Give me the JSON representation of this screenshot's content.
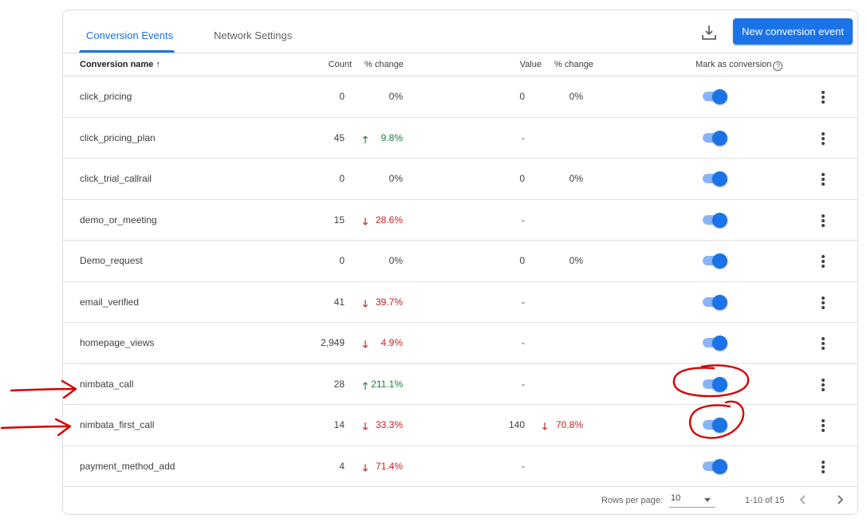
{
  "tabs": [
    {
      "label": "Conversion Events",
      "active": true
    },
    {
      "label": "Network Settings",
      "active": false
    }
  ],
  "toolbar": {
    "download_icon": "download-icon",
    "new_button_label": "New conversion event"
  },
  "columns": {
    "name": "Conversion name",
    "sort_indicator": "↑",
    "count": "Count",
    "count_change": "% change",
    "value": "Value",
    "value_change": "% change",
    "mark": "Mark as conversion",
    "help": "?"
  },
  "rows": [
    {
      "name": "click_pricing",
      "count": "0",
      "count_trend": "",
      "count_change": "0%",
      "value": "0",
      "value_trend": "",
      "value_change": "0%",
      "marked": true
    },
    {
      "name": "click_pricing_plan",
      "count": "45",
      "count_trend": "up",
      "count_change": "9.8%",
      "value": "-",
      "value_trend": "",
      "value_change": "",
      "marked": true
    },
    {
      "name": "click_trial_callrail",
      "count": "0",
      "count_trend": "",
      "count_change": "0%",
      "value": "0",
      "value_trend": "",
      "value_change": "0%",
      "marked": true
    },
    {
      "name": "demo_or_meeting",
      "count": "15",
      "count_trend": "down",
      "count_change": "28.6%",
      "value": "-",
      "value_trend": "",
      "value_change": "",
      "marked": true
    },
    {
      "name": "Demo_request",
      "count": "0",
      "count_trend": "",
      "count_change": "0%",
      "value": "0",
      "value_trend": "",
      "value_change": "0%",
      "marked": true
    },
    {
      "name": "email_verified",
      "count": "41",
      "count_trend": "down",
      "count_change": "39.7%",
      "value": "-",
      "value_trend": "",
      "value_change": "",
      "marked": true
    },
    {
      "name": "homepage_views",
      "count": "2,949",
      "count_trend": "down",
      "count_change": "4.9%",
      "value": "-",
      "value_trend": "",
      "value_change": "",
      "marked": true
    },
    {
      "name": "nimbata_call",
      "count": "28",
      "count_trend": "up",
      "count_change": "211.1%",
      "value": "-",
      "value_trend": "",
      "value_change": "",
      "marked": true
    },
    {
      "name": "nimbata_first_call",
      "count": "14",
      "count_trend": "down",
      "count_change": "33.3%",
      "value": "140",
      "value_trend": "down",
      "value_change": "70.8%",
      "marked": true
    },
    {
      "name": "payment_method_add",
      "count": "4",
      "count_trend": "down",
      "count_change": "71.4%",
      "value": "-",
      "value_trend": "",
      "value_change": "",
      "marked": true
    }
  ],
  "footer": {
    "rows_per_page_label": "Rows per page:",
    "rows_per_page_value": "10",
    "range": "1-10 of 15"
  },
  "colors": {
    "accent": "#1a73e8",
    "up": "#188038",
    "down": "#c5221f",
    "annotation": "#d50000"
  }
}
